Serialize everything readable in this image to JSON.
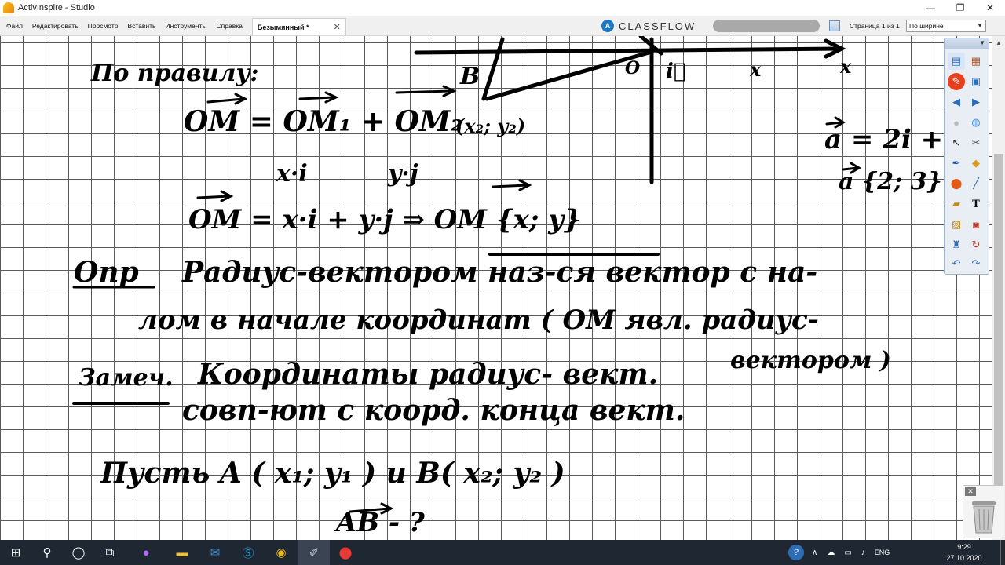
{
  "window": {
    "title": "ActivInspire - Studio",
    "controls": {
      "minimize": "—",
      "maximize": "❐",
      "close": "✕"
    }
  },
  "menu": [
    "Файл",
    "Редактировать",
    "Просмотр",
    "Вставить",
    "Инструменты",
    "Справка"
  ],
  "document_tab": {
    "label": "Безымянный *",
    "close": "✕"
  },
  "classflow": {
    "logo": "A",
    "label": "CLASSFLOW"
  },
  "page_indicator": "Страница 1 из 1",
  "zoom": {
    "value": "По ширине"
  },
  "board": {
    "axes_labels": {
      "origin": "O",
      "x_axis": "x",
      "x_point": "x",
      "i_vector": "i⃗",
      "b_point": "B",
      "b_coords": "(x₂; y₂)"
    },
    "line_by_rule": "По правилу:",
    "eq1": "OM = OM₁ + OM₂",
    "eq_sub": {
      "left": "x·i",
      "right": "y·j"
    },
    "eq2": "OM = x·i + y·j  ⇒  OM {x; y}",
    "side_a": "a = 2i + 3",
    "side_coords": "a {2; 3}",
    "def_label": "Опр",
    "def_line1": "Радиус-вектором наз-ся вектор с на-",
    "def_line2": "лом в начале координат   ( OM явл. радиус-",
    "def_line2b": "вектором )",
    "note_label": "Замеч.",
    "note_line1": "Координаты радиус- вект.",
    "note_line2": "совп-ют с коорд. конца вект.",
    "let_line": "Пусть  A ( x₁; y₁ )  и  B( x₂; y₂ )",
    "ab_line": "AB  - ?"
  },
  "toolbox": {
    "icons": [
      "main-menu-icon",
      "browser-icon",
      "pen-red-icon",
      "resource-icon",
      "page-prev-icon",
      "page-next-icon",
      "record-icon",
      "globe-icon",
      "select-icon",
      "tools-icon",
      "pen-icon",
      "fill-icon",
      "shape-icon",
      "highlighter-icon",
      "clipart-icon",
      "text-icon",
      "gallery-icon",
      "camera-icon",
      "spotlight-icon",
      "restore-icon",
      "undo-icon",
      "redo-icon"
    ]
  },
  "trash": {
    "close": "✕"
  },
  "taskbar": {
    "start": "⊞",
    "search": "⚲",
    "task_view": "◯",
    "tray_help": "?",
    "tray_chevron": "∧",
    "tray_lang": "ENG",
    "time": "9:29",
    "date": "27.10.2020"
  },
  "colors": {
    "ink": "#000000",
    "grid": "#5a5a5a",
    "taskbar": "#1f2733",
    "menubar": "#f0f0f0",
    "accent": "#1d78c1"
  }
}
